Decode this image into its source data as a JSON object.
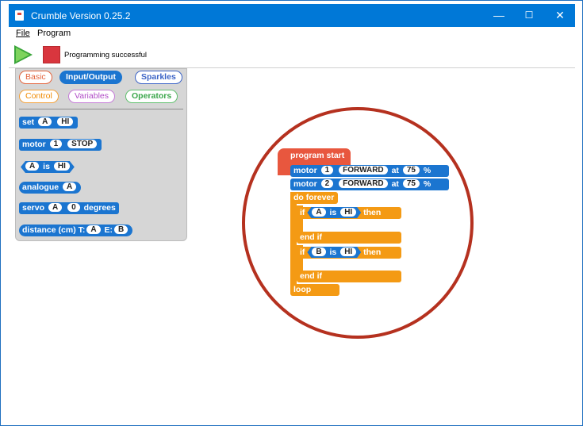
{
  "window": {
    "title": "Crumble Version 0.25.2",
    "minimize": "—",
    "maximize": "☐",
    "close": "✕"
  },
  "menu": {
    "file": "File",
    "program": "Program"
  },
  "toolbar": {
    "status": "Programming successful"
  },
  "palette": {
    "categories": {
      "basic": "Basic",
      "io": "Input/Output",
      "sparkles": "Sparkles",
      "control": "Control",
      "variables": "Variables",
      "operators": "Operators"
    },
    "blocks": {
      "set": {
        "label": "set",
        "var": "A",
        "value": "HI"
      },
      "motor": {
        "label": "motor",
        "num": "1",
        "state": "STOP"
      },
      "compare": {
        "var": "A",
        "is": "is",
        "value": "HI"
      },
      "analogue": {
        "label": "analogue",
        "var": "A"
      },
      "servo": {
        "label": "servo",
        "var": "A",
        "num": "0",
        "unit": "degrees"
      },
      "distance": {
        "label": "distance (cm)",
        "t": "T:",
        "t_var": "A",
        "e": "E:",
        "e_var": "B"
      }
    }
  },
  "program": {
    "start": "program start",
    "motor1": {
      "label": "motor",
      "num": "1",
      "dir": "FORWARD",
      "at": "at",
      "speed": "75",
      "pct": "%"
    },
    "motor2": {
      "label": "motor",
      "num": "2",
      "dir": "FORWARD",
      "at": "at",
      "speed": "75",
      "pct": "%"
    },
    "forever": "do forever",
    "if1": {
      "if": "if",
      "var": "A",
      "is": "is",
      "value": "HI",
      "then": "then",
      "end": "end if"
    },
    "if2": {
      "if": "if",
      "var": "B",
      "is": "is",
      "value": "HI",
      "then": "then",
      "end": "end if"
    },
    "loop": "loop"
  },
  "colors": {
    "titlebar": "#0078d7",
    "io_blue": "#1b75d0",
    "control_orange": "#f49a14",
    "start_red": "#e8573e",
    "highlight_circle": "#b5311f"
  }
}
